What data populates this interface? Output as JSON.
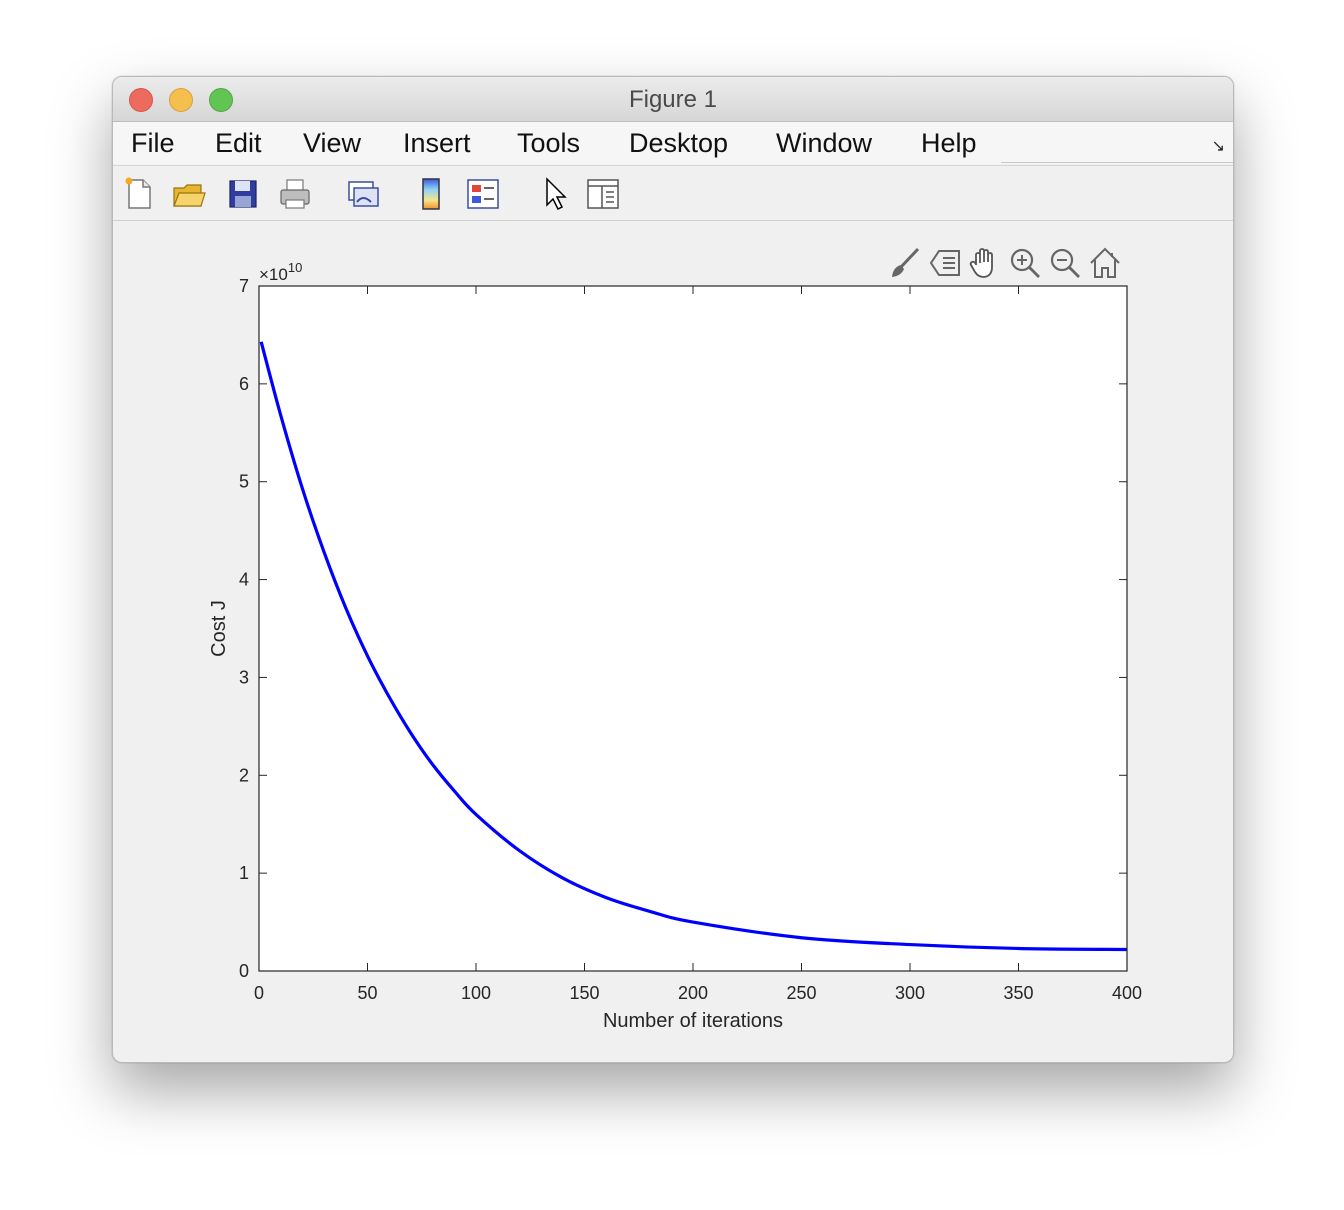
{
  "window": {
    "title": "Figure 1"
  },
  "menu": [
    "File",
    "Edit",
    "View",
    "Insert",
    "Tools",
    "Desktop",
    "Window",
    "Help"
  ],
  "toolbar": [
    {
      "icon": "new-figure-icon"
    },
    {
      "icon": "open-file-icon"
    },
    {
      "icon": "save-icon"
    },
    {
      "icon": "print-icon"
    },
    {
      "icon": "link-plot-icon"
    },
    {
      "icon": "insert-colorbar-icon"
    },
    {
      "icon": "insert-legend-icon"
    },
    {
      "icon": "edit-pointer-icon"
    },
    {
      "icon": "property-inspector-icon"
    }
  ],
  "axes_toolbar": [
    {
      "icon": "brush-icon"
    },
    {
      "icon": "data-tips-icon"
    },
    {
      "icon": "pan-hand-icon"
    },
    {
      "icon": "zoom-in-icon"
    },
    {
      "icon": "zoom-out-icon"
    },
    {
      "icon": "home-restore-view-icon"
    }
  ],
  "chart_data": {
    "type": "line",
    "title": "",
    "xlabel": "Number of iterations",
    "ylabel": "Cost J",
    "y_exponent_base": "×10",
    "y_exponent_power": "10",
    "xlim": [
      0,
      400
    ],
    "ylim": [
      0,
      7
    ],
    "xticks": [
      "0",
      "50",
      "100",
      "150",
      "200",
      "250",
      "300",
      "350",
      "400"
    ],
    "yticks": [
      "0",
      "1",
      "2",
      "3",
      "4",
      "5",
      "6",
      "7"
    ],
    "grid": false,
    "color": "#0000ff",
    "series": [
      {
        "x": [
          1,
          10,
          20,
          30,
          40,
          50,
          60,
          70,
          80,
          90,
          100,
          120,
          140,
          160,
          180,
          200,
          250,
          300,
          350,
          400
        ],
        "y": [
          6.43,
          5.68,
          4.93,
          4.28,
          3.71,
          3.22,
          2.8,
          2.43,
          2.11,
          1.84,
          1.6,
          1.23,
          0.95,
          0.75,
          0.61,
          0.5,
          0.34,
          0.27,
          0.23,
          0.22
        ]
      }
    ]
  }
}
